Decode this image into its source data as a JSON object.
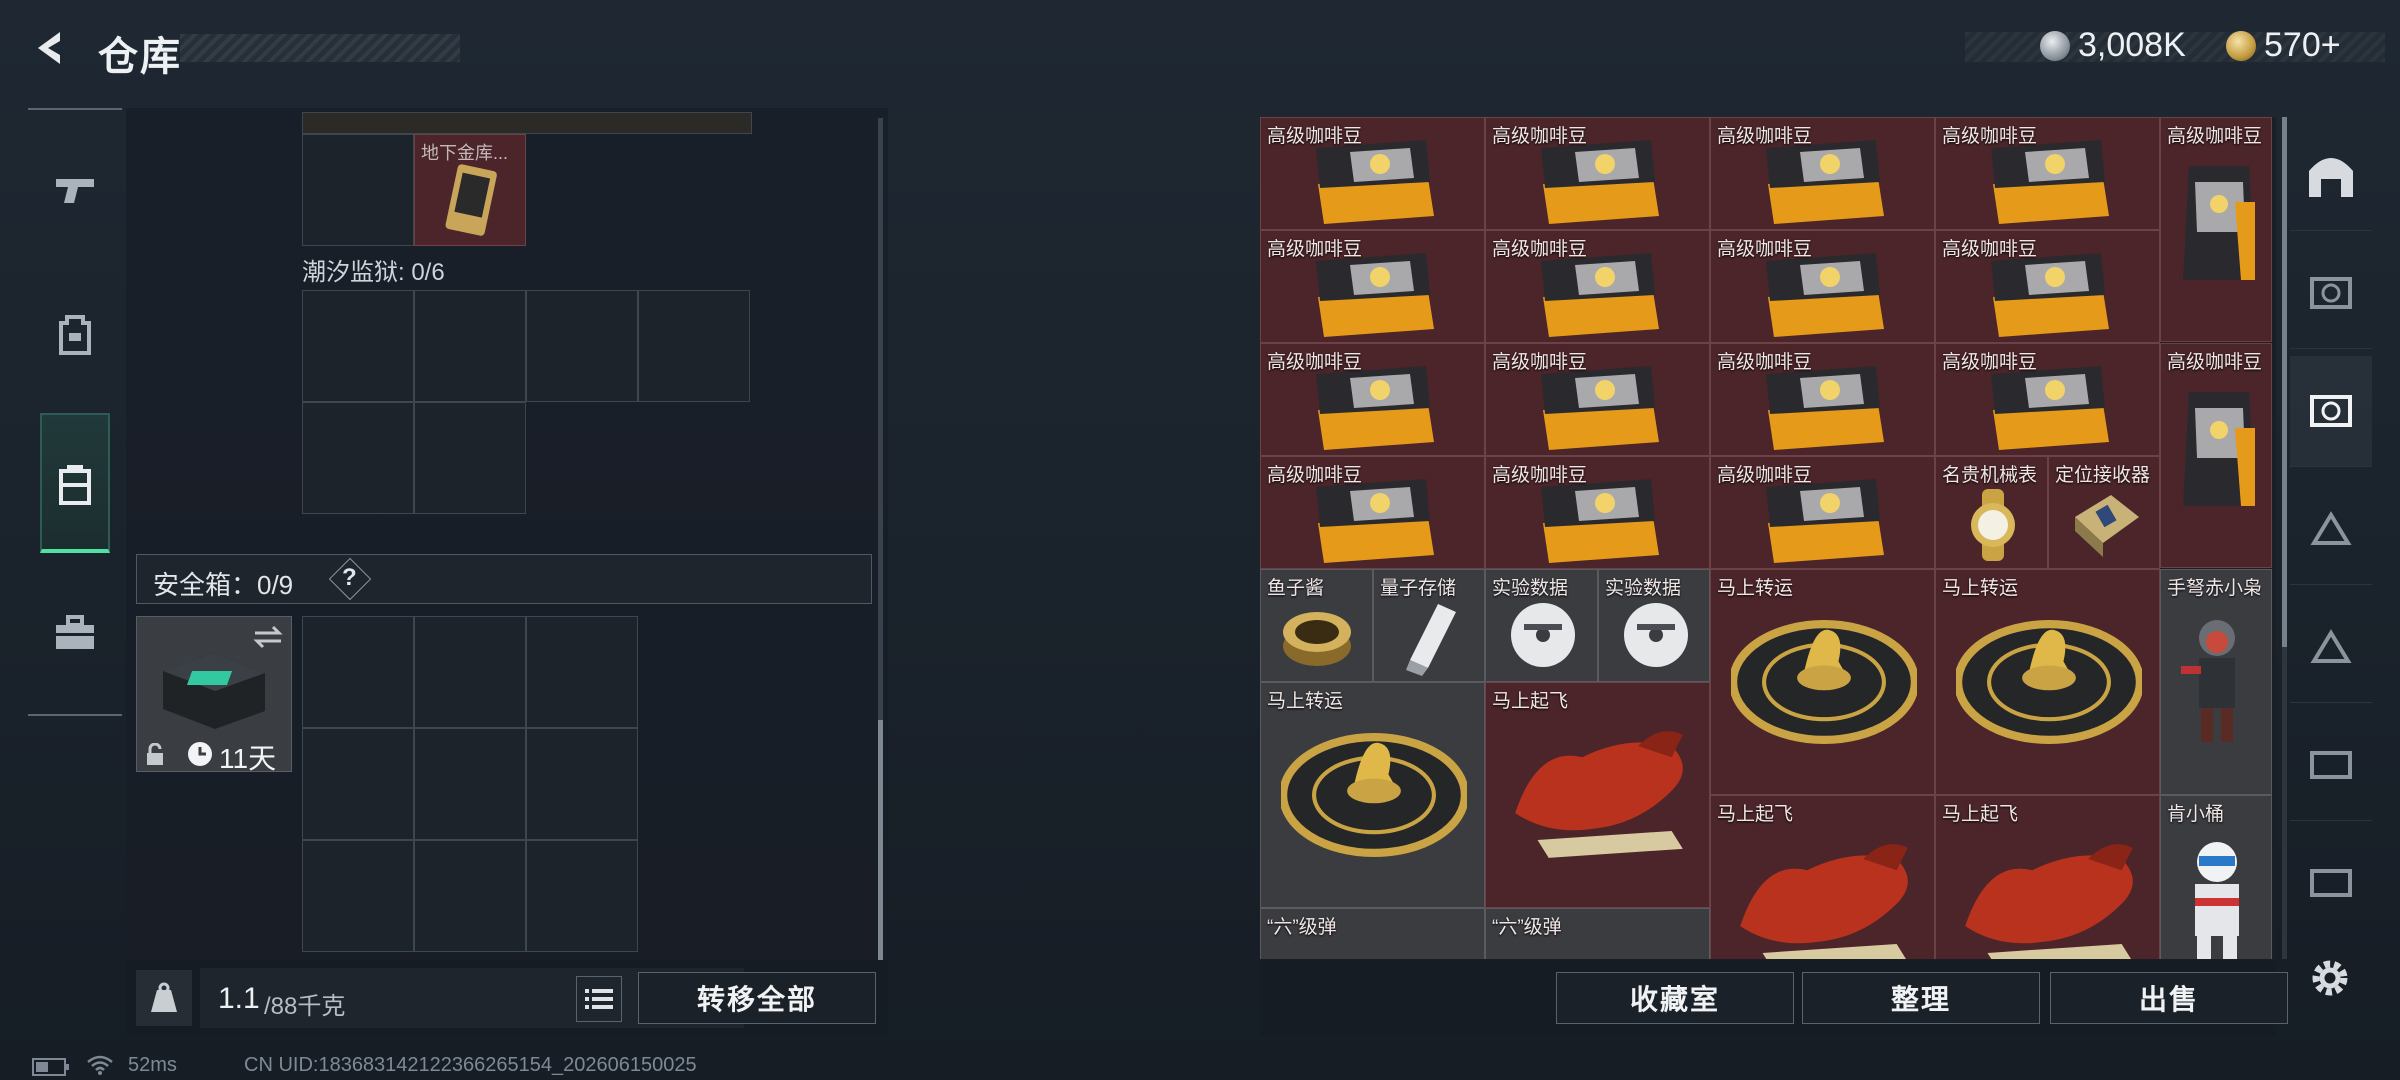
{
  "header": {
    "title": "仓库",
    "currency_1": "3,008K",
    "currency_2": "570+"
  },
  "left": {
    "top_item_label": "地下金库...",
    "prison_label": "潮汐监狱: 0/6",
    "safe_label": "安全箱：0/9",
    "safe_help": "?",
    "safe_timer": "11天",
    "weight_value": "1.1",
    "weight_unit": "/88千克",
    "transfer_all": "转移全部"
  },
  "right": {
    "items": [
      {
        "name": "高级咖啡豆"
      },
      {
        "name": "高级咖啡豆"
      },
      {
        "name": "高级咖啡豆"
      },
      {
        "name": "高级咖啡豆"
      },
      {
        "name": "高级咖啡豆"
      },
      {
        "name": "高级咖啡豆"
      },
      {
        "name": "高级咖啡豆"
      },
      {
        "name": "高级咖啡豆"
      },
      {
        "name": "高级咖啡豆"
      },
      {
        "name": "高级咖啡豆"
      },
      {
        "name": "高级咖啡豆"
      },
      {
        "name": "高级咖啡豆"
      },
      {
        "name": "高级咖啡豆"
      },
      {
        "name": "高级咖啡豆"
      },
      {
        "name": "高级咖啡豆"
      },
      {
        "name": "高级咖啡豆"
      },
      {
        "name": "高级咖啡豆"
      },
      {
        "name": "名贵机械表"
      },
      {
        "name": "定位接收器"
      },
      {
        "name": "鱼子酱"
      },
      {
        "name": "量子存储"
      },
      {
        "name": "实验数据"
      },
      {
        "name": "实验数据"
      },
      {
        "name": "马上转运"
      },
      {
        "name": "马上转运"
      },
      {
        "name": "手弩赤小枭"
      },
      {
        "name": "马上转运"
      },
      {
        "name": "马上起飞"
      },
      {
        "name": "马上起飞"
      },
      {
        "name": "马上起飞"
      },
      {
        "name": "肯小桶"
      },
      {
        "name": "“六”级弹"
      },
      {
        "name": "“六”级弹"
      }
    ],
    "buttons": {
      "collection": "收藏室",
      "sort": "整理",
      "sell": "出售"
    }
  },
  "status_bar": {
    "ping": "52ms",
    "uid": "CN UID:18368314212236626515​4_202606150025"
  }
}
